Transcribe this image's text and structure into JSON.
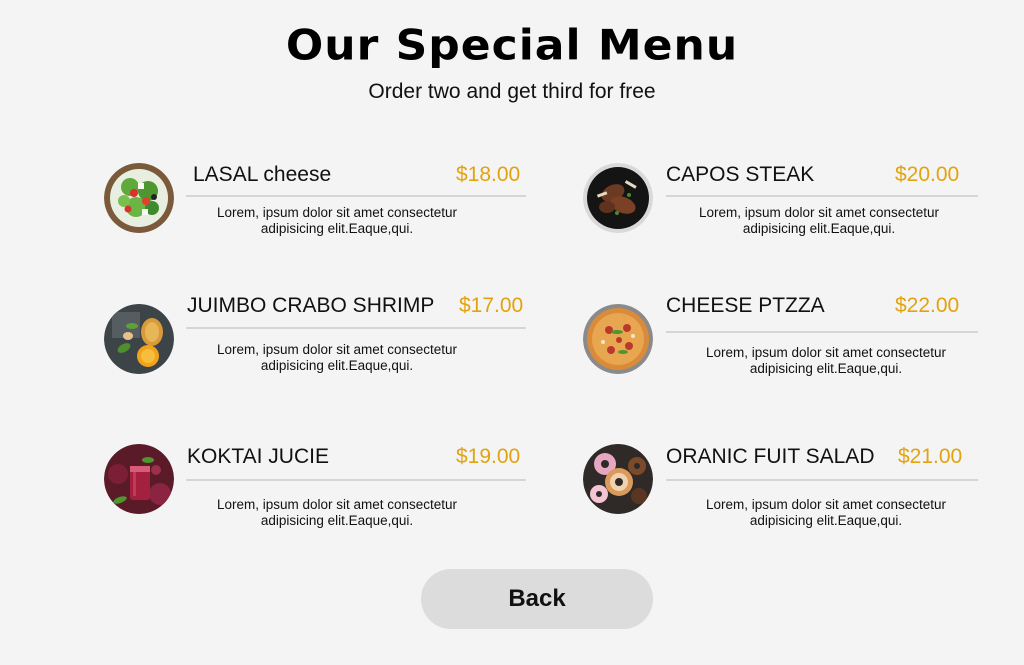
{
  "header": {
    "title": "Our Special Menu",
    "subtitle": "Order two and get third for free"
  },
  "menu": [
    {
      "name": "LASAL cheese",
      "price": "$18.00",
      "desc_line1": "Lorem, ipsum dolor sit amet consectetur",
      "desc_line2": "adipisicing elit.Eaque,qui.",
      "icon": "salad-photo"
    },
    {
      "name": "CAPOS STEAK",
      "price": "$20.00",
      "desc_line1": "Lorem, ipsum dolor sit amet consectetur",
      "desc_line2": "adipisicing elit.Eaque,qui.",
      "icon": "steak-photo"
    },
    {
      "name": "JUIMBO CRABO SHRIMP",
      "price": "$17.00",
      "desc_line1": "Lorem, ipsum dolor sit amet consectetur",
      "desc_line2": "adipisicing elit.Eaque,qui.",
      "icon": "shrimp-photo"
    },
    {
      "name": "CHEESE PTZZA",
      "price": "$22.00",
      "desc_line1": "Lorem, ipsum dolor sit amet consectetur",
      "desc_line2": "adipisicing elit.Eaque,qui.",
      "icon": "pizza-photo"
    },
    {
      "name": "KOKTAI JUCIE",
      "price": "$19.00",
      "desc_line1": "Lorem, ipsum dolor sit amet consectetur",
      "desc_line2": "adipisicing elit.Eaque,qui.",
      "icon": "juice-photo"
    },
    {
      "name": "ORANIC FUIT SALAD",
      "price": "$21.00",
      "desc_line1": "Lorem, ipsum dolor sit amet consectetur",
      "desc_line2": "adipisicing elit.Eaque,qui.",
      "icon": "donut-photo"
    }
  ],
  "footer": {
    "back_label": "Back"
  },
  "colors": {
    "background": "#f4f4f4",
    "price": "#e2a30f",
    "button": "#dcdcdc",
    "divider": "#d6d6d6"
  }
}
